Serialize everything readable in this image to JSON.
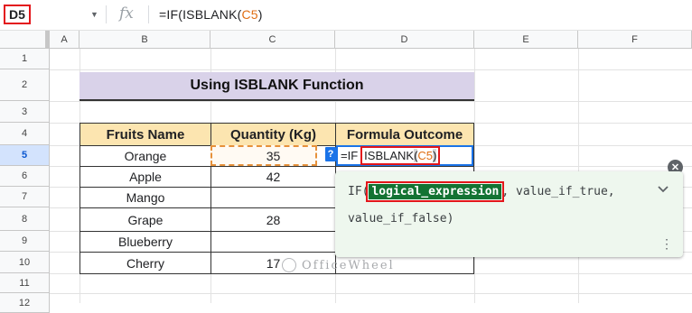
{
  "formula_bar": {
    "cell_ref": "D5",
    "fx_label": "fx",
    "formula_prefix": "=IF(ISBLANK(",
    "formula_ref": "C5",
    "formula_suffix": ")"
  },
  "columns": [
    "A",
    "B",
    "C",
    "D",
    "E",
    "F"
  ],
  "rows": [
    "1",
    "2",
    "3",
    "4",
    "5",
    "6",
    "7",
    "8",
    "9",
    "10",
    "11",
    "12"
  ],
  "sheet": {
    "title": "Using ISBLANK Function",
    "headers": [
      "Fruits Name",
      "Quantity (Kg)",
      "Formula Outcome"
    ],
    "fruits": [
      "Orange",
      "Apple",
      "Mango",
      "Grape",
      "Blueberry",
      "Cherry"
    ],
    "quantities": [
      "35",
      "42",
      "",
      "28",
      "",
      "17"
    ]
  },
  "edit_cell": {
    "prefix": "=IF",
    "func": "ISBLANK",
    "ref": "C5",
    "q_badge": "?"
  },
  "tooltip": {
    "fn": "IF(",
    "arg1": "logical_expression",
    "sep": ",",
    "arg2": "value_if_true,",
    "arg3": "value_if_false)"
  },
  "watermark": "OfficeWheel",
  "colors": {
    "title_bg": "#d9d2e9",
    "header_bg": "#fce5b0",
    "highlight_red": "#e3161b",
    "selection_blue": "#1a73e8",
    "tooltip_arg": "#137333"
  }
}
